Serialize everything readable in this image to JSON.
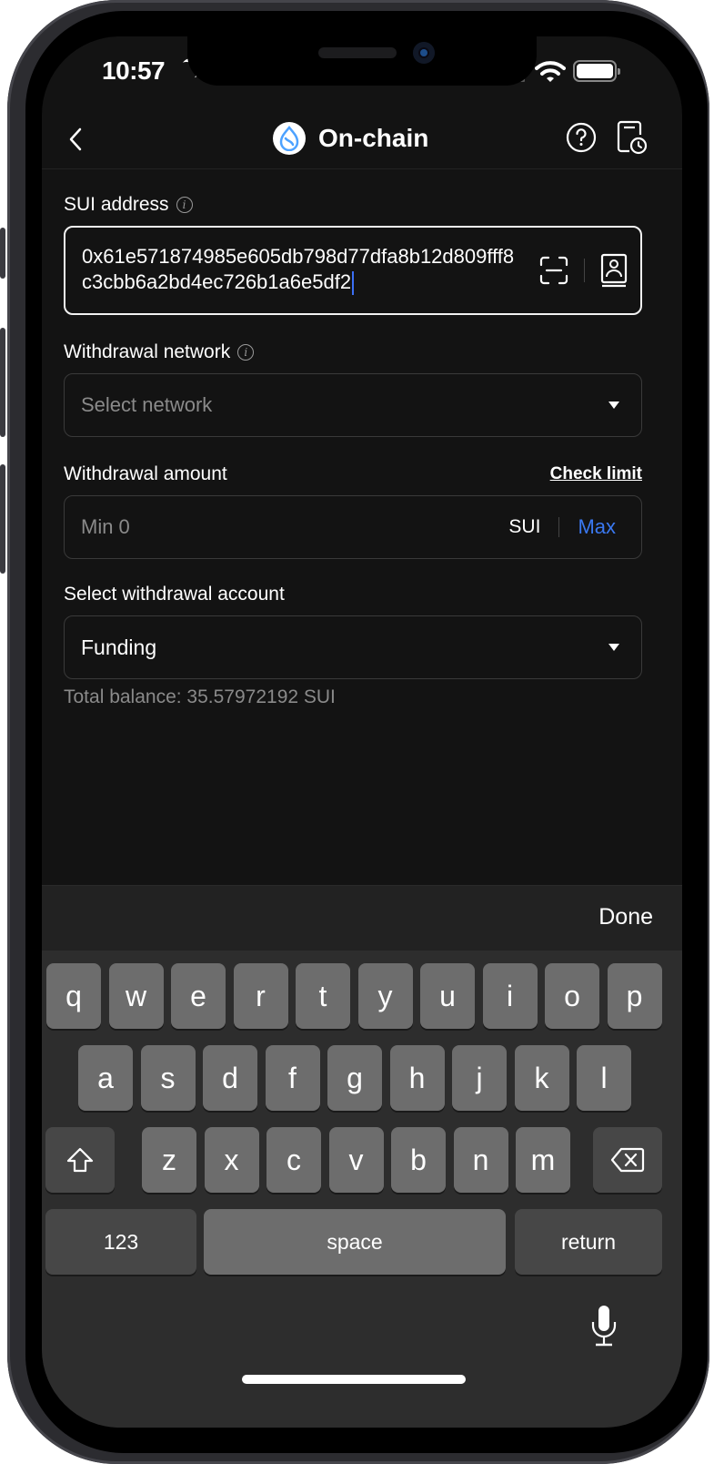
{
  "status_bar": {
    "time": "10:57"
  },
  "nav": {
    "title": "On-chain",
    "icons": {
      "back": "back-chevron-icon",
      "logo": "sui-logo-icon",
      "help": "help-question-icon",
      "history": "history-record-icon"
    }
  },
  "form": {
    "address": {
      "label": "SUI address",
      "value": "0x61e571874985e605db798d77dfa8b12d809fff8c3cbb6a2bd4ec726b1a6e5df2"
    },
    "network": {
      "label": "Withdrawal network",
      "placeholder": "Select network"
    },
    "amount": {
      "label": "Withdrawal amount",
      "check_limit": "Check limit",
      "placeholder": "Min 0",
      "unit": "SUI",
      "max_label": "Max"
    },
    "account": {
      "label": "Select withdrawal account",
      "value": "Funding",
      "balance": "Total balance: 35.57972192 SUI"
    }
  },
  "colors": {
    "accent": "#3a78f0",
    "background": "#131313",
    "sui_blue": "#4da2ff"
  },
  "keyboard": {
    "done_label": "Done",
    "row1": [
      "q",
      "w",
      "e",
      "r",
      "t",
      "y",
      "u",
      "i",
      "o",
      "p"
    ],
    "row2": [
      "a",
      "s",
      "d",
      "f",
      "g",
      "h",
      "j",
      "k",
      "l"
    ],
    "row3": [
      "z",
      "x",
      "c",
      "v",
      "b",
      "n",
      "m"
    ],
    "numbers_label": "123",
    "space_label": "space",
    "return_label": "return"
  }
}
